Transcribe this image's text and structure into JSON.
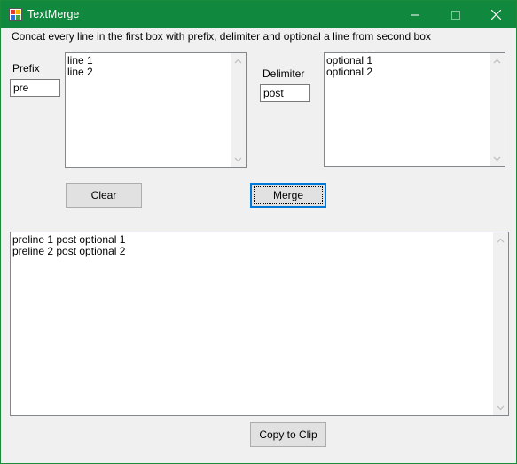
{
  "window": {
    "title": "TextMerge",
    "titlebar_color": "#10893e"
  },
  "description": "Concat every line in the first box with prefix, delimiter and optional a line from second box",
  "prefix": {
    "label": "Prefix",
    "value": "pre"
  },
  "delimiter": {
    "label": "Delimiter",
    "value": "post"
  },
  "input_lines": [
    "line 1",
    "line 2"
  ],
  "optional_lines": [
    "optional 1",
    "optional 2"
  ],
  "buttons": {
    "clear": "Clear",
    "merge": "Merge",
    "copy": "Copy to Clip"
  },
  "output_lines": [
    "preline 1 post optional 1",
    "preline 2 post optional 2"
  ],
  "icons": [
    "app-icon",
    "minimize-icon",
    "maximize-icon",
    "close-icon",
    "scroll-up-icon",
    "scroll-down-icon"
  ]
}
